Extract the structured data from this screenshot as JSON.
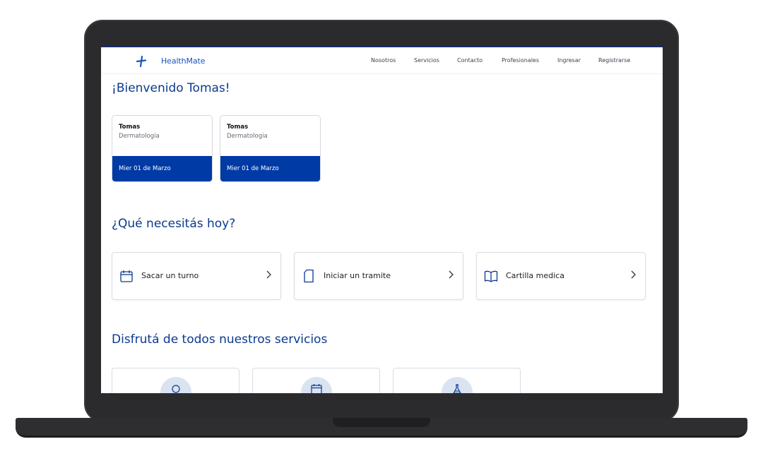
{
  "app": {
    "brand": "HealthMate",
    "accent_color": "#003aa5",
    "brand_color": "#1554c5"
  },
  "nav": {
    "links": [
      "Nosotros",
      "Servicios",
      "Contacto",
      "Profesionales",
      "Ingresar",
      "Registrarse"
    ]
  },
  "welcome": {
    "title": "¡Bienvenido Tomas!"
  },
  "appointments": [
    {
      "name": "Tomas",
      "specialty": "Dermatologia",
      "date": "Mier 01 de Marzo"
    },
    {
      "name": "Tomas",
      "specialty": "Dermatologia",
      "date": "Mier 01 de Marzo"
    }
  ],
  "needs": {
    "title": "¿Qué necesitás hoy?",
    "actions": [
      {
        "label": "Sacar un turno",
        "icon": "calendar-icon"
      },
      {
        "label": "Iniciar un tramite",
        "icon": "document-icon"
      },
      {
        "label": "Cartilla medica",
        "icon": "book-icon"
      }
    ]
  },
  "services": {
    "title": "Disfrutá de todos nuestros servicios",
    "cards": [
      {
        "icon": "circle-icon"
      },
      {
        "icon": "calendar-icon"
      },
      {
        "icon": "flask-icon"
      }
    ]
  }
}
